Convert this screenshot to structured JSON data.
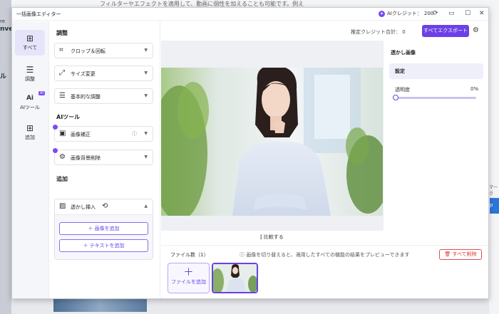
{
  "background": {
    "top_text": "フィルターやエフェクトを適用して、動画に個性を加えることも可能です。例え",
    "left_text_a": "re",
    "left_text_b": "nve",
    "left_text_c": "ル",
    "right_text": "マーク",
    "right_button": "p"
  },
  "window": {
    "title": "一括画像エディター",
    "credit_label": "AIクレジット：",
    "credit_value": "200",
    "icons": [
      "refresh-icon",
      "cart-icon",
      "maximize-icon",
      "close-icon"
    ]
  },
  "rail": {
    "items": [
      {
        "label": "すべて",
        "icon": "⊞"
      },
      {
        "label": "調整",
        "icon": "☰"
      },
      {
        "label": "AIツール",
        "icon": "Ai",
        "badge": "AI"
      },
      {
        "label": "追加",
        "icon": "⊞"
      }
    ]
  },
  "panel": {
    "sections": {
      "adjust": "調整",
      "ai_tools": "AIツール",
      "add": "追加"
    },
    "adjust_items": [
      {
        "label": "クロップ＆回転"
      },
      {
        "label": "サイズ変更"
      },
      {
        "label": "基本的な調整"
      }
    ],
    "ai_items": [
      {
        "label": "画像補正"
      },
      {
        "label": "画像背景削除"
      }
    ],
    "watermark": {
      "label": "透かし挿入",
      "add_image": "画像を追加",
      "add_text": "テキストを追加"
    }
  },
  "header": {
    "estimated_credits_label": "推定クレジット合計：",
    "estimated_credits_value": "0",
    "export_button": "すべてエクスポート"
  },
  "compare": {
    "label": "比較する"
  },
  "settings": {
    "title": "透かし画像",
    "section": "設定",
    "opacity_label": "透明度",
    "opacity_value": "0%",
    "opacity_fraction": 0
  },
  "files": {
    "count_label": "ファイル数（1）",
    "hint": "画像を切り替えると、適用したすべての機能の結果をプレビューできます",
    "delete_all": "すべて削除",
    "add_file": "ファイルを追加"
  },
  "colors": {
    "accent": "#6b40e6",
    "danger": "#e34d4d",
    "rail_active": "#e6e4fb"
  }
}
